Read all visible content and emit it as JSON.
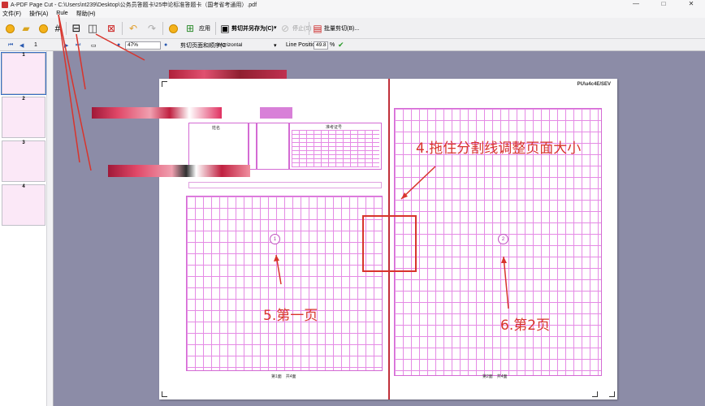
{
  "window": {
    "title": "A-PDF Page Cut - C:\\Users\\nt239\\Desktop\\公务员答题卡\\25申论标准答题卡（国考省考通用）.pdf",
    "controls": [
      "—",
      "□",
      "✕"
    ]
  },
  "menu": [
    "文件(F)",
    "操作(A)",
    "Rule",
    "帮助(H)"
  ],
  "toolbar": {
    "apply_label": "应用",
    "cut_save_label": "剪切并另存为(C)",
    "stop_label": "停止(S)",
    "batch_label": "批量剪切(B)..."
  },
  "toolbar2": {
    "page_number": "1",
    "zoom": "47%",
    "mode_label": "剪切页面和顺序(C",
    "mode_value": "Horizontal",
    "line_position_label": "Line Position:",
    "line_position_value": "49.8",
    "line_position_unit": "%"
  },
  "thumbnails": [
    "1",
    "2",
    "3",
    "4"
  ],
  "document": {
    "corner_label": "PU\\u4c4E/SEV",
    "circle1": "1",
    "circle2": "2",
    "info_title": "准考证号",
    "name_label": "姓名",
    "bottom_left": "第1面　共4面",
    "bottom_right": "第2面　共4面"
  },
  "annotations": {
    "a4": "4.拖住分割线调整页面大小",
    "a5": "5.第一页",
    "a6": "6.第2页"
  },
  "colors": {
    "canvas": "#8c8ca7",
    "grid": "#e58be5",
    "annotation": "#d8342c",
    "split_line": "#c0303a"
  }
}
